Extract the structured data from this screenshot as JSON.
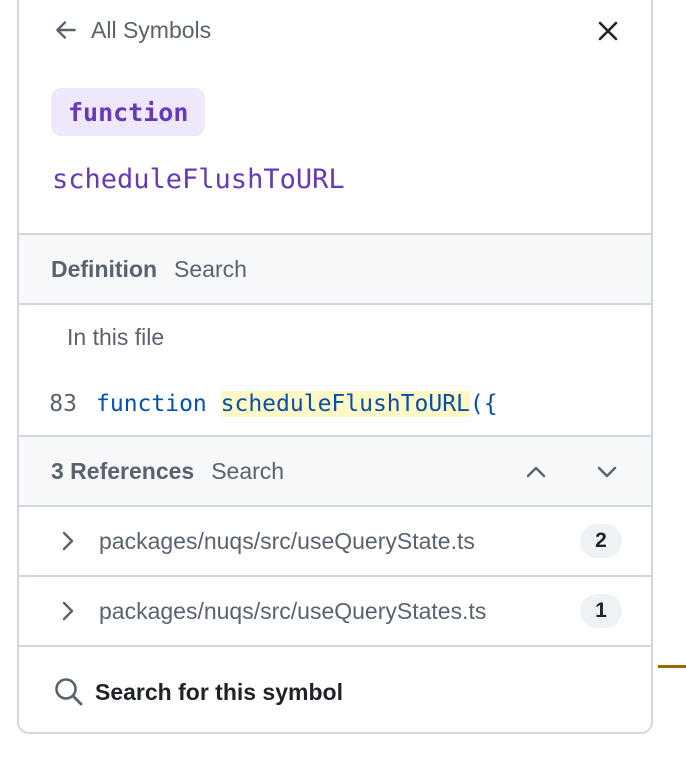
{
  "header": {
    "back_label": "All Symbols",
    "back_icon": "arrow-left-icon",
    "close_icon": "close-icon"
  },
  "symbol": {
    "kind": "function",
    "name": "scheduleFlushToURL"
  },
  "definition": {
    "title": "Definition",
    "search_label": "Search",
    "scope_label": "In this file",
    "line_number": "83",
    "code_keyword": "function",
    "code_symbol": "scheduleFlushToURL",
    "code_rest": "({"
  },
  "references": {
    "title": "3 References",
    "search_label": "Search",
    "items": [
      {
        "path": "packages/nuqs/src/useQueryState.ts",
        "count": "2"
      },
      {
        "path": "packages/nuqs/src/useQueryStates.ts",
        "count": "1"
      }
    ]
  },
  "footer": {
    "search_symbol_label": "Search for this symbol",
    "search_icon": "search-icon"
  },
  "colors": {
    "accent_purple": "#6639ba",
    "badge_bg": "#efe8fb",
    "code_blue": "#0550ae",
    "highlight": "#fff8c5",
    "border": "#d0d7de",
    "header_bg": "#f6f8fa"
  }
}
